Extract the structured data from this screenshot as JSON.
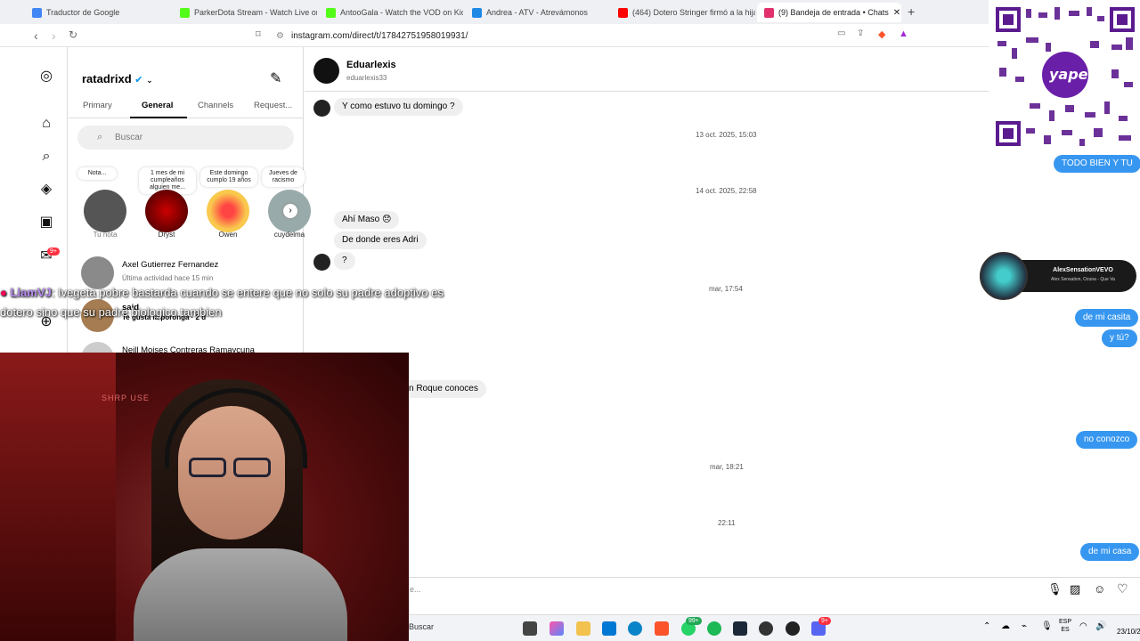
{
  "browser": {
    "tabs": [
      {
        "title": "Traductor de Google",
        "color": "#4285f4"
      },
      {
        "title": "ParkerDota Stream - Watch Live on K",
        "color": "#53fc18"
      },
      {
        "title": "AntooGala - Watch the VOD on Kick",
        "color": "#53fc18"
      },
      {
        "title": "Andrea - ATV - Atrevámonos",
        "color": "#1e88e5"
      },
      {
        "title": "(464) Dotero Stringer firmó a la hija d",
        "color": "#ff0000"
      },
      {
        "title": "(9) Bandeja de entrada • Chats",
        "color": "#e1306c"
      }
    ],
    "url": "instagram.com/direct/t/17842751958019931/"
  },
  "rail": {
    "notif_badge": "9+"
  },
  "inbox": {
    "username": "ratadrixd",
    "tabs": [
      "Primary",
      "General",
      "Channels",
      "Request..."
    ],
    "active_tab": "General",
    "search_placeholder": "Buscar",
    "notes": [
      {
        "note": "Nota...",
        "name": "Tu nota"
      },
      {
        "note": "1 mes de mi cumpleaños alguien me...",
        "name": "Dryst"
      },
      {
        "note": "Este domingo cumplo 19 años",
        "name": "Owen"
      },
      {
        "note": "Jueves de racismo",
        "name": "cuydelma"
      }
    ],
    "threads": [
      {
        "name": "Axel Gutierrez Fernandez",
        "sub": "Última actividad hace 15 min"
      },
      {
        "name": "said",
        "sub": "Te gusta la poronga · 2 d"
      },
      {
        "name": "Neill Moises Contreras Ramaycuna",
        "sub": ""
      }
    ]
  },
  "chat": {
    "contact_name": "Eduarlexis",
    "contact_handle": "eduarlexis33",
    "messages": {
      "m1": "Y como estuvo tu domingo ?",
      "ts1": "13 oct. 2025, 15:03",
      "o1": "TODO BIEN  Y TU",
      "ts2": "14 oct. 2025, 22:58",
      "m2": "Ahí Maso 😞",
      "m3": "De donde eres Adri",
      "m4": "?",
      "ts3": "mar, 17:54",
      "o2": "de mi casita",
      "o3": "y tú?",
      "m5": "n Roque conoces",
      "o4": "no conozco",
      "ts4": "mar, 18:21",
      "ts5": "22:11",
      "o5": "de mi casa"
    },
    "composer_placeholder": "e..."
  },
  "overlay": {
    "chat_user": "LiamVJ",
    "chat_text": ": Ivegeta pobre bastarda cuando se entere que no solo su padre adoptivo es dotero sino que su padre biologico tambien",
    "cam_sign": "SHRP USE",
    "qr_brand": "yape",
    "now_playing_title": "AlexSensationVEVO",
    "now_playing_sub": "Alex Sensation, Ozuna - Que Va"
  },
  "taskbar": {
    "search": "Buscar",
    "lang": "ESP",
    "lang2": "ES",
    "date": "23/10/2",
    "badge1": "99+",
    "badge2": "9+"
  }
}
